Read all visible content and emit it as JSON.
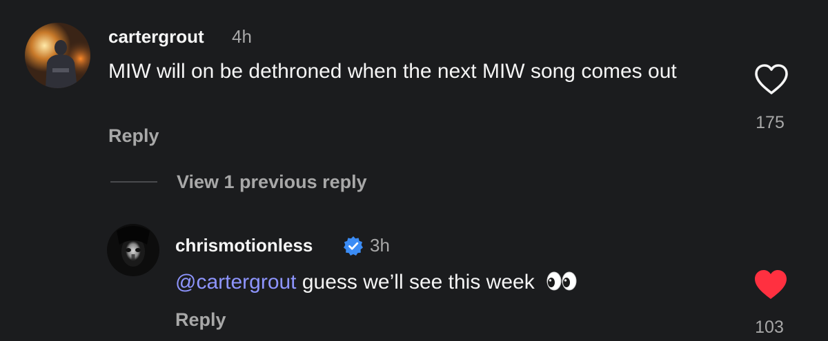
{
  "comment": {
    "avatar_icon": "user-photo-icon",
    "username": "cartergrout",
    "time": "4h",
    "text": "MIW will on be dethroned when the next MIW song comes out",
    "reply_label": "Reply",
    "like_icon": "heart-outline-icon",
    "likes": "175",
    "liked": false
  },
  "view_replies": {
    "label": "View 1 previous reply"
  },
  "reply": {
    "avatar_icon": "user-photo-icon",
    "username": "chrismotionless",
    "verified": true,
    "verified_icon": "verified-badge-icon",
    "time": "3h",
    "mention": "@cartergrout",
    "text": "guess we’ll see this week",
    "emoji": "eyes-emoji-icon",
    "reply_label": "Reply",
    "like_icon": "heart-filled-icon",
    "likes": "103",
    "liked": true
  },
  "colors": {
    "background": "#1b1c1e",
    "primary_text": "#f5f5f5",
    "secondary_text": "#a8a8a8",
    "mention": "#8e95ff",
    "like_active": "#ff3040",
    "verified": "#3b8cf5"
  }
}
